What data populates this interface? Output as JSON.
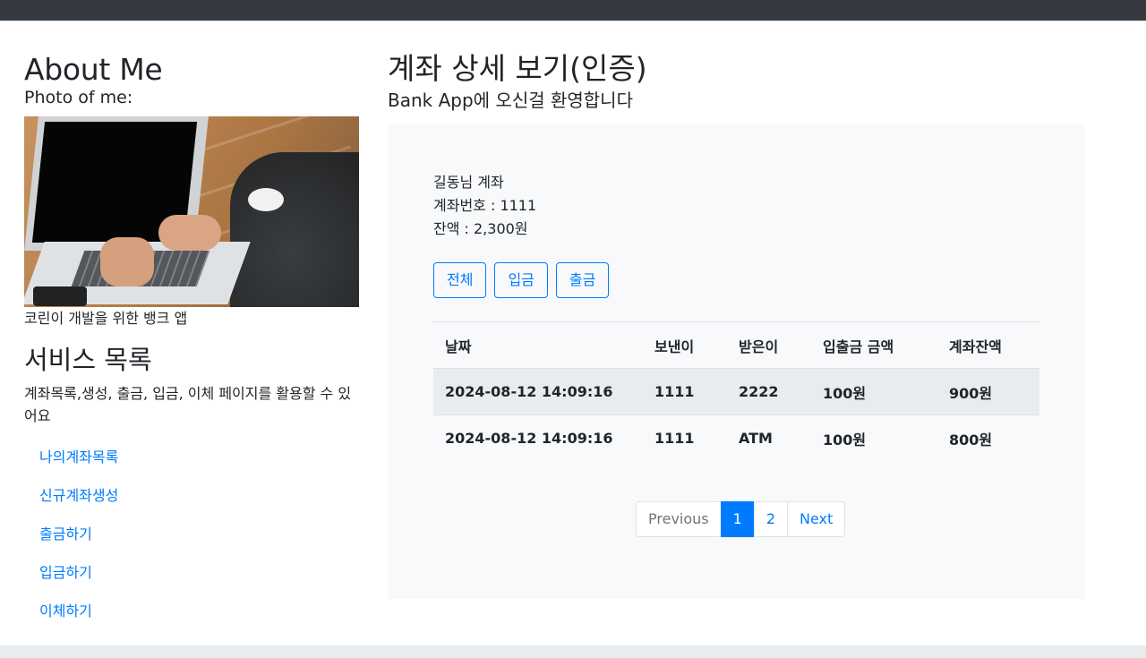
{
  "sidebar": {
    "title": "About Me",
    "photo_label": "Photo of me:",
    "caption": "코린이 개발을 위한 뱅크 앱",
    "services_title": "서비스 목록",
    "services_desc": "계좌목록,생성, 출금, 입금, 이체 페이지를 활용할 수 있어요",
    "links": [
      {
        "label": "나의계좌목록"
      },
      {
        "label": "신규계좌생성"
      },
      {
        "label": "출금하기"
      },
      {
        "label": "입금하기"
      },
      {
        "label": "이체하기"
      }
    ]
  },
  "main": {
    "title": "계좌 상세 보기(인증)",
    "subtitle_bold": "Bank App",
    "subtitle_rest": "에 오신걸 환영합니다",
    "account": {
      "owner_line": "길동님 계좌",
      "number_line": "계좌번호 : 1111",
      "balance_line": "잔액 : 2,300원"
    },
    "filters": [
      "전체",
      "입금",
      "출금"
    ],
    "table": {
      "headers": [
        "날짜",
        "보낸이",
        "받은이",
        "입출금 금액",
        "계좌잔액"
      ],
      "rows": [
        [
          "2024-08-12 14:09:16",
          "1111",
          "2222",
          "100원",
          "900원"
        ],
        [
          "2024-08-12 14:09:16",
          "1111",
          "ATM",
          "100원",
          "800원"
        ]
      ]
    },
    "pagination": {
      "previous": "Previous",
      "pages": [
        "1",
        "2"
      ],
      "current": "1",
      "next": "Next"
    }
  },
  "colors": {
    "topbar": "#343a40",
    "accent": "#007bff",
    "panel_bg": "#f8f9fa",
    "striped_row": "#e9ecef"
  }
}
